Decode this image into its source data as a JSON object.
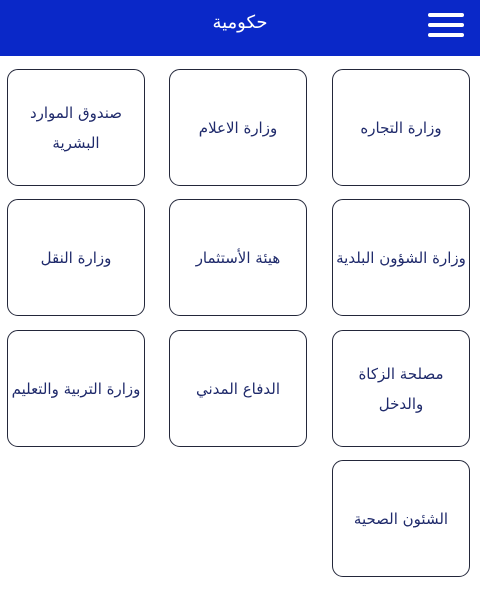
{
  "header": {
    "title": "حكومية",
    "menu_icon": "hamburger-menu-icon",
    "background_color": "#0a28c8"
  },
  "tiles": [
    {
      "label": "وزارة التجاره"
    },
    {
      "label": "وزارة الاعلام"
    },
    {
      "label": "صندوق الموارد البشرية"
    },
    {
      "label": "وزارة الشؤون البلدية"
    },
    {
      "label": "هيئة الأستثمار"
    },
    {
      "label": "وزارة النقل"
    },
    {
      "label": "مصلحة الزكاة والدخل"
    },
    {
      "label": "الدفاع المدني"
    },
    {
      "label": "وزارة التربية والتعليم"
    },
    {
      "label": "الشئون الصحية"
    }
  ],
  "colors": {
    "tile_border": "#23273a",
    "tile_text": "#1f2a6b"
  }
}
